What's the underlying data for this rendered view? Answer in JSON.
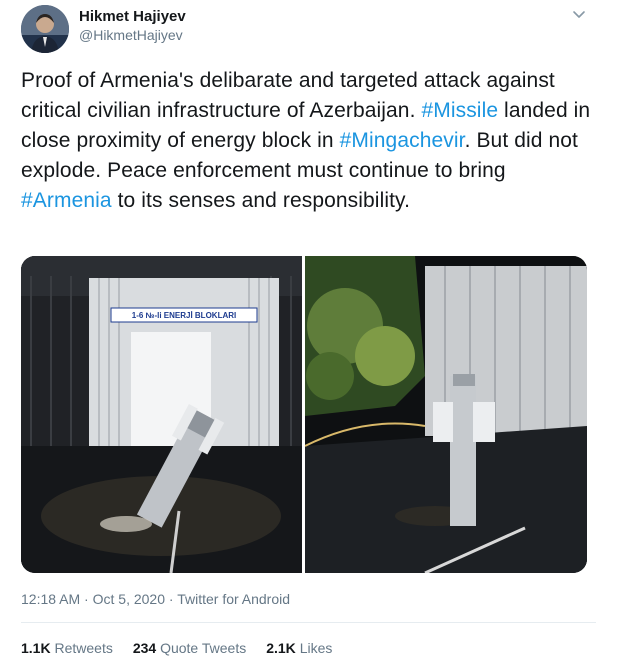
{
  "author": {
    "name": "Hikmet Hajiyev",
    "handle": "@HikmetHajiyev"
  },
  "tweet": {
    "segments": [
      {
        "text": "Proof of Armenia's delibarate and targeted attack against critical civilian infrastructure of Azerbaijan. ",
        "hashtag": false
      },
      {
        "text": "#Missile",
        "hashtag": true
      },
      {
        "text": " landed in close proximity of energy block in ",
        "hashtag": false
      },
      {
        "text": "#Mingachevir",
        "hashtag": true
      },
      {
        "text": ". But did not explode. Peace enforcement must continue to bring ",
        "hashtag": false
      },
      {
        "text": "#Armenia",
        "hashtag": true
      },
      {
        "text": " to its senses and responsibility.",
        "hashtag": false
      }
    ]
  },
  "media": {
    "left_sign": "1-6 №-li ENERJİ BLOKLARI"
  },
  "meta": {
    "time": "12:18 AM",
    "separator": "·",
    "date": "Oct 5, 2020",
    "source": "Twitter for Android"
  },
  "stats": {
    "retweets_count": "1.1K",
    "retweets_label": "Retweets",
    "quotes_count": "234",
    "quotes_label": "Quote Tweets",
    "likes_count": "2.1K",
    "likes_label": "Likes"
  },
  "colors": {
    "hashtag": "#1b95e0",
    "secondary_text": "#657786",
    "primary_text": "#14171a"
  },
  "icons": {
    "menu": "chevron-down-icon"
  }
}
